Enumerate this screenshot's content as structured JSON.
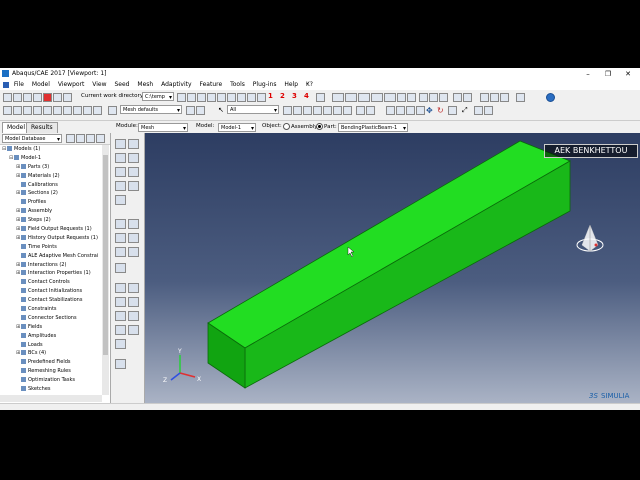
{
  "window": {
    "title": "Abaqus/CAE 2017 [Viewport: 1]",
    "min": "–",
    "max": "❐",
    "close": "✕"
  },
  "menu": [
    "File",
    "Model",
    "Viewport",
    "View",
    "Seed",
    "Mesh",
    "Adaptivity",
    "Feature",
    "Tools",
    "Plug-ins",
    "Help",
    "₭?"
  ],
  "toolbar": {
    "workdir_label": "Current work directory:",
    "workdir_value": "C:\\temp",
    "mesh_defaults": "Mesh defaults",
    "selection_filter": "All",
    "numbers": [
      "1",
      "2",
      "3",
      "4"
    ]
  },
  "context": {
    "tab_model": "Model",
    "tab_results": "Results",
    "module_label": "Module:",
    "module_value": "Mesh",
    "model_label": "Model:",
    "model_value": "Model-1",
    "object_label": "Object:",
    "assembly_label": "Assembly",
    "part_label": "Part:",
    "part_value": "BendingPlasticBeam-1"
  },
  "tree": {
    "database": "Model Database",
    "items": [
      {
        "label": "Models (1)",
        "level": 0,
        "exp": "⊟"
      },
      {
        "label": "Model-1",
        "level": 1,
        "exp": "⊟"
      },
      {
        "label": "Parts (3)",
        "level": 2,
        "exp": "⊞"
      },
      {
        "label": "Materials (2)",
        "level": 2,
        "exp": "⊞"
      },
      {
        "label": "Calibrations",
        "level": 2,
        "exp": ""
      },
      {
        "label": "Sections (2)",
        "level": 2,
        "exp": "⊞"
      },
      {
        "label": "Profiles",
        "level": 2,
        "exp": ""
      },
      {
        "label": "Assembly",
        "level": 2,
        "exp": "⊞"
      },
      {
        "label": "Steps (2)",
        "level": 2,
        "exp": "⊞"
      },
      {
        "label": "Field Output Requests (1)",
        "level": 2,
        "exp": "⊞"
      },
      {
        "label": "History Output Requests (1)",
        "level": 2,
        "exp": "⊞"
      },
      {
        "label": "Time Points",
        "level": 2,
        "exp": ""
      },
      {
        "label": "ALE Adaptive Mesh Constrai",
        "level": 2,
        "exp": ""
      },
      {
        "label": "Interactions (2)",
        "level": 2,
        "exp": "⊞"
      },
      {
        "label": "Interaction Properties (1)",
        "level": 2,
        "exp": "⊞"
      },
      {
        "label": "Contact Controls",
        "level": 2,
        "exp": ""
      },
      {
        "label": "Contact Initializations",
        "level": 2,
        "exp": ""
      },
      {
        "label": "Contact Stabilizations",
        "level": 2,
        "exp": ""
      },
      {
        "label": "Constraints",
        "level": 2,
        "exp": ""
      },
      {
        "label": "Connector Sections",
        "level": 2,
        "exp": ""
      },
      {
        "label": "Fields",
        "level": 2,
        "exp": "⊞"
      },
      {
        "label": "Amplitudes",
        "level": 2,
        "exp": ""
      },
      {
        "label": "Loads",
        "level": 2,
        "exp": ""
      },
      {
        "label": "BCs (4)",
        "level": 2,
        "exp": "⊞"
      },
      {
        "label": "Predefined Fields",
        "level": 2,
        "exp": ""
      },
      {
        "label": "Remeshing Rules",
        "level": 2,
        "exp": ""
      },
      {
        "label": "Optimization Tasks",
        "level": 2,
        "exp": ""
      },
      {
        "label": "Sketches",
        "level": 2,
        "exp": ""
      }
    ]
  },
  "viewport": {
    "watermark": "AEK BENKHETTOU",
    "logo": "SIMULIA",
    "triad": {
      "y": "Y",
      "z": "Z",
      "x": "X"
    },
    "beam_color": "#22dd22",
    "beam_side_color": "#19b819",
    "beam_end_color": "#11a411"
  }
}
